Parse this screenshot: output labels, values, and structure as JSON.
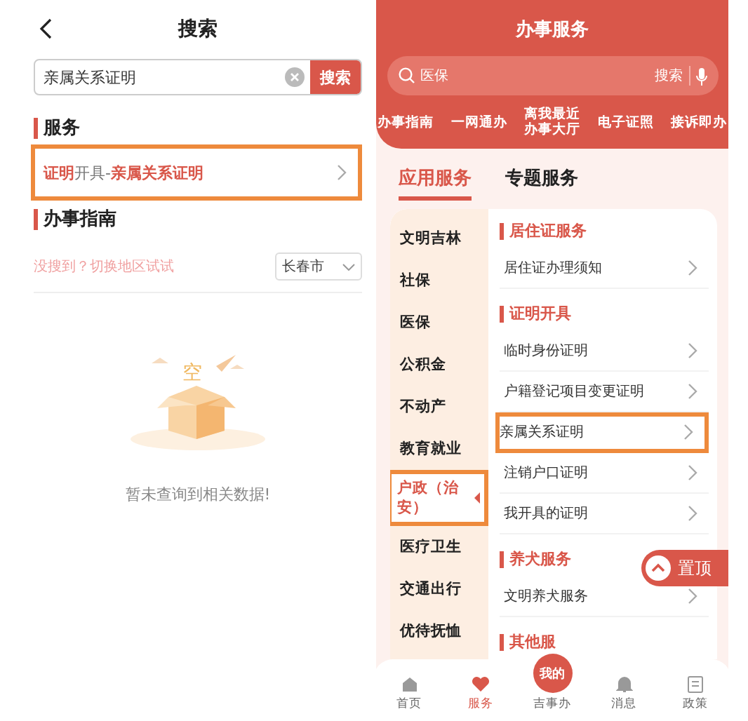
{
  "search_page": {
    "title": "搜索",
    "search": {
      "value": "亲属关系证明",
      "button": "搜索"
    },
    "services_heading": "服务",
    "service_results": [
      {
        "text": "**证明**开具-**亲属关系证明**",
        "highlighted": true
      }
    ],
    "guide_heading": "办事指南",
    "region_hint": "没搜到？切换地区试试",
    "region_select": "长春市",
    "empty_mark": "空",
    "empty_message": "暂未查询到相关数据!"
  },
  "services_page": {
    "title": "办事服务",
    "search": {
      "placeholder": "医保",
      "button": "搜索"
    },
    "quick_links": [
      "办事指南",
      "一网通办",
      "离我最近办事大厅",
      "电子证照",
      "接诉即办"
    ],
    "tabs": [
      {
        "label": "应用服务",
        "selected": true
      },
      {
        "label": "专题服务",
        "selected": false
      }
    ],
    "categories": [
      {
        "label": "文明吉林",
        "selected": false,
        "highlighted": false
      },
      {
        "label": "社保",
        "selected": false,
        "highlighted": false
      },
      {
        "label": "医保",
        "selected": false,
        "highlighted": false
      },
      {
        "label": "公积金",
        "selected": false,
        "highlighted": false
      },
      {
        "label": "不动产",
        "selected": false,
        "highlighted": false
      },
      {
        "label": "教育就业",
        "selected": false,
        "highlighted": false
      },
      {
        "label": "户政（治安）",
        "selected": true,
        "highlighted": true
      },
      {
        "label": "医疗卫生",
        "selected": false,
        "highlighted": false
      },
      {
        "label": "交通出行",
        "selected": false,
        "highlighted": false
      },
      {
        "label": "优待抚恤",
        "selected": false,
        "highlighted": false
      }
    ],
    "sections": [
      {
        "title": "居住证服务",
        "items": [
          {
            "label": "居住证办理须知",
            "highlighted": false
          }
        ]
      },
      {
        "title": "证明开具",
        "items": [
          {
            "label": "临时身份证明",
            "highlighted": false
          },
          {
            "label": "户籍登记项目变更证明",
            "highlighted": false
          },
          {
            "label": "亲属关系证明",
            "highlighted": true
          },
          {
            "label": "注销户口证明",
            "highlighted": false
          },
          {
            "label": "我开具的证明",
            "highlighted": false
          }
        ]
      },
      {
        "title": "养犬服务",
        "items": [
          {
            "label": "文明养犬服务",
            "highlighted": false
          }
        ]
      },
      {
        "title": "其他服"
      }
    ],
    "top_button": "置顶",
    "bottom_nav": [
      {
        "label": "首页",
        "kind": "home",
        "selected": false
      },
      {
        "label": "服务",
        "kind": "heart",
        "selected": true
      },
      {
        "label": "吉事办",
        "kind": "center",
        "badge": "我的",
        "selected": false
      },
      {
        "label": "消息",
        "kind": "bell",
        "selected": false
      },
      {
        "label": "政策",
        "kind": "doc",
        "selected": false
      }
    ]
  }
}
